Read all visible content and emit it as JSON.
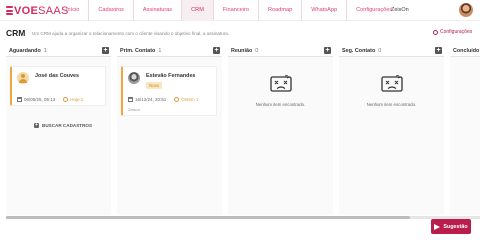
{
  "app": {
    "logo_text": "VOE",
    "logo_suffix": "SAAS",
    "brand_color": "#d42a5c"
  },
  "nav": {
    "items": [
      {
        "label": "Início",
        "active": false
      },
      {
        "label": "Cadastros",
        "active": false
      },
      {
        "label": "Assinaturas",
        "active": false
      },
      {
        "label": "CRM",
        "active": true
      },
      {
        "label": "Financeiro",
        "active": false
      },
      {
        "label": "Roadmap",
        "active": false
      },
      {
        "label": "WhatsApp",
        "active": false
      },
      {
        "label": "Configurações",
        "active": false
      }
    ],
    "user_name": "ZeisOn"
  },
  "header": {
    "title": "CRM",
    "subtitle": "Um CRM ajuda a organizar o relacionamento com o cliente visando o objetivo final, a assinatura.",
    "config_label": "Configurações"
  },
  "columns": [
    {
      "title": "Aguardando",
      "count": "1"
    },
    {
      "title": "Prim. Contato",
      "count": "1"
    },
    {
      "title": "Reunião",
      "count": "0"
    },
    {
      "title": "Seg. Contato",
      "count": "0"
    },
    {
      "title": "Concluído",
      "count": ""
    }
  ],
  "cards": {
    "aguardando": {
      "name": "José das Couves",
      "date": "06/05/25, 05:13",
      "age": "Hoje 1"
    },
    "prim_contato": {
      "name": "Estevão Fernandes",
      "tag": "Novo",
      "date": "16/12/24, 20:51",
      "age": "Ontem 1",
      "owner": "Zeison"
    }
  },
  "load_more_label": "BUSCAR CADASTROS",
  "empty_text": "Nenhum item encontrado.",
  "suggest_button": "Sugestão",
  "icons": {
    "gear": "gear-icon",
    "add": "plus-square-icon",
    "calendar": "calendar-icon",
    "clock": "clock-icon",
    "empty": "sad-box-icon",
    "send": "paper-plane-icon"
  }
}
